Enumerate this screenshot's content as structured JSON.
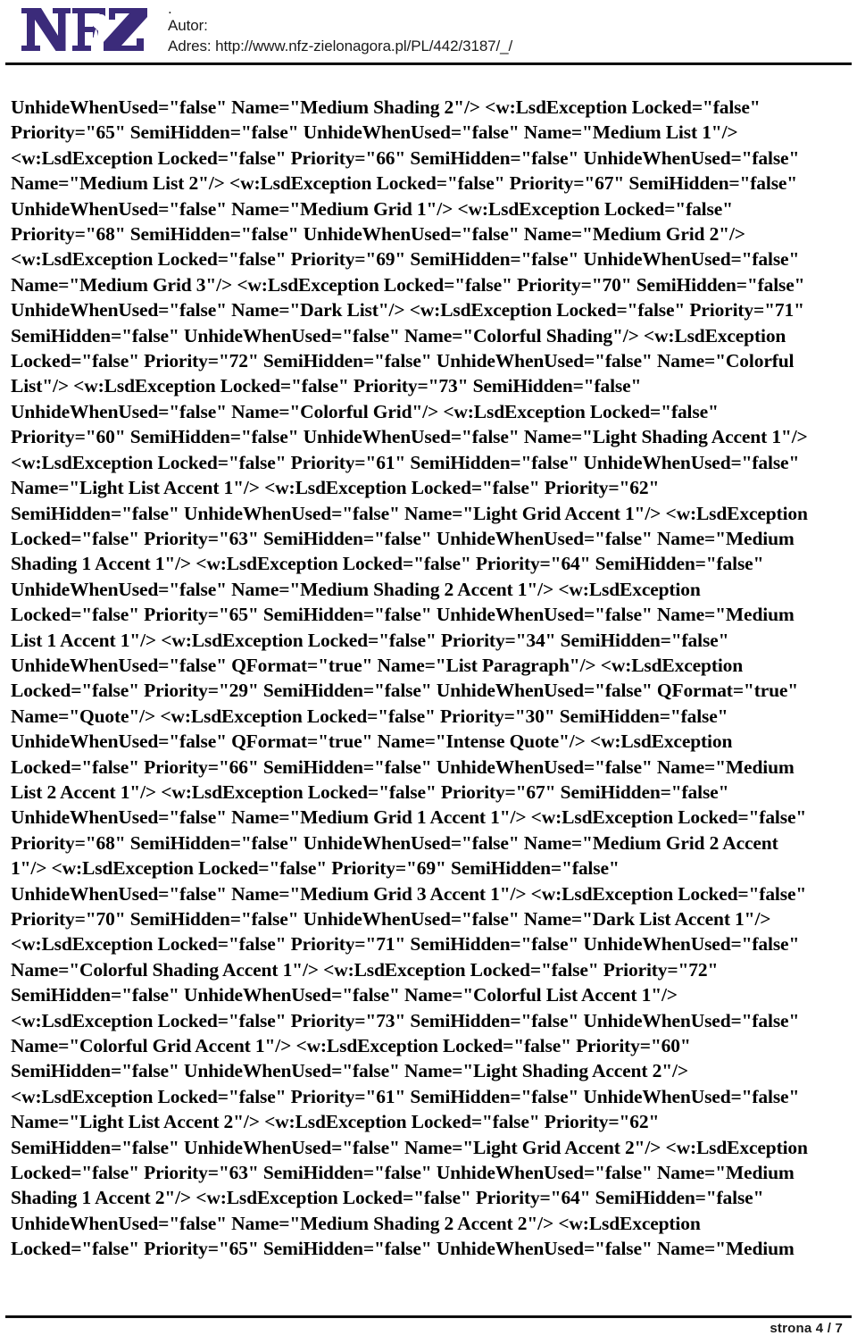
{
  "header": {
    "logo_alt": "NFZ",
    "logo_color": "#3B2B7A",
    "meta_lines": [
      ".",
      "Autor:",
      "Adres: http://www.nfz-zielonagora.pl/PL/442/3187/_/"
    ]
  },
  "body": {
    "lines": [
      "UnhideWhenUsed=\"false\" Name=\"Medium Shading 2\"/> <w:LsdException Locked=\"false\"",
      "Priority=\"65\" SemiHidden=\"false\" UnhideWhenUsed=\"false\" Name=\"Medium List 1\"/>",
      "<w:LsdException Locked=\"false\" Priority=\"66\" SemiHidden=\"false\" UnhideWhenUsed=\"false\"",
      "Name=\"Medium List 2\"/> <w:LsdException Locked=\"false\" Priority=\"67\" SemiHidden=\"false\"",
      "UnhideWhenUsed=\"false\" Name=\"Medium Grid 1\"/> <w:LsdException Locked=\"false\"",
      "Priority=\"68\" SemiHidden=\"false\" UnhideWhenUsed=\"false\" Name=\"Medium Grid 2\"/>",
      "<w:LsdException Locked=\"false\" Priority=\"69\" SemiHidden=\"false\" UnhideWhenUsed=\"false\"",
      "Name=\"Medium Grid 3\"/> <w:LsdException Locked=\"false\" Priority=\"70\" SemiHidden=\"false\"",
      "UnhideWhenUsed=\"false\" Name=\"Dark List\"/> <w:LsdException Locked=\"false\" Priority=\"71\"",
      "SemiHidden=\"false\" UnhideWhenUsed=\"false\" Name=\"Colorful Shading\"/> <w:LsdException",
      "Locked=\"false\" Priority=\"72\" SemiHidden=\"false\" UnhideWhenUsed=\"false\" Name=\"Colorful",
      "List\"/> <w:LsdException Locked=\"false\" Priority=\"73\" SemiHidden=\"false\"",
      "UnhideWhenUsed=\"false\" Name=\"Colorful Grid\"/> <w:LsdException Locked=\"false\"",
      "Priority=\"60\" SemiHidden=\"false\" UnhideWhenUsed=\"false\" Name=\"Light Shading Accent 1\"/>",
      "<w:LsdException Locked=\"false\" Priority=\"61\" SemiHidden=\"false\" UnhideWhenUsed=\"false\"",
      "Name=\"Light List Accent 1\"/> <w:LsdException Locked=\"false\" Priority=\"62\"",
      "SemiHidden=\"false\" UnhideWhenUsed=\"false\" Name=\"Light Grid Accent 1\"/> <w:LsdException",
      "Locked=\"false\" Priority=\"63\" SemiHidden=\"false\" UnhideWhenUsed=\"false\" Name=\"Medium",
      "Shading 1 Accent 1\"/> <w:LsdException Locked=\"false\" Priority=\"64\" SemiHidden=\"false\"",
      "UnhideWhenUsed=\"false\" Name=\"Medium Shading 2 Accent 1\"/> <w:LsdException",
      "Locked=\"false\" Priority=\"65\" SemiHidden=\"false\" UnhideWhenUsed=\"false\" Name=\"Medium",
      "List 1 Accent 1\"/> <w:LsdException Locked=\"false\" Priority=\"34\" SemiHidden=\"false\"",
      "UnhideWhenUsed=\"false\" QFormat=\"true\" Name=\"List Paragraph\"/> <w:LsdException",
      "Locked=\"false\" Priority=\"29\" SemiHidden=\"false\" UnhideWhenUsed=\"false\" QFormat=\"true\"",
      "Name=\"Quote\"/> <w:LsdException Locked=\"false\" Priority=\"30\" SemiHidden=\"false\"",
      "UnhideWhenUsed=\"false\" QFormat=\"true\" Name=\"Intense Quote\"/> <w:LsdException",
      "Locked=\"false\" Priority=\"66\" SemiHidden=\"false\" UnhideWhenUsed=\"false\" Name=\"Medium",
      "List 2 Accent 1\"/> <w:LsdException Locked=\"false\" Priority=\"67\" SemiHidden=\"false\"",
      "UnhideWhenUsed=\"false\" Name=\"Medium Grid 1 Accent 1\"/> <w:LsdException Locked=\"false\"",
      "Priority=\"68\" SemiHidden=\"false\" UnhideWhenUsed=\"false\" Name=\"Medium Grid 2 Accent",
      "1\"/> <w:LsdException Locked=\"false\" Priority=\"69\" SemiHidden=\"false\"",
      "UnhideWhenUsed=\"false\" Name=\"Medium Grid 3 Accent 1\"/> <w:LsdException Locked=\"false\"",
      "Priority=\"70\" SemiHidden=\"false\" UnhideWhenUsed=\"false\" Name=\"Dark List Accent 1\"/>",
      "<w:LsdException Locked=\"false\" Priority=\"71\" SemiHidden=\"false\" UnhideWhenUsed=\"false\"",
      "Name=\"Colorful Shading Accent 1\"/> <w:LsdException Locked=\"false\" Priority=\"72\"",
      "SemiHidden=\"false\" UnhideWhenUsed=\"false\" Name=\"Colorful List Accent 1\"/>",
      "<w:LsdException Locked=\"false\" Priority=\"73\" SemiHidden=\"false\" UnhideWhenUsed=\"false\"",
      "Name=\"Colorful Grid Accent 1\"/> <w:LsdException Locked=\"false\" Priority=\"60\"",
      "SemiHidden=\"false\" UnhideWhenUsed=\"false\" Name=\"Light Shading Accent 2\"/>",
      "<w:LsdException Locked=\"false\" Priority=\"61\" SemiHidden=\"false\" UnhideWhenUsed=\"false\"",
      "Name=\"Light List Accent 2\"/> <w:LsdException Locked=\"false\" Priority=\"62\"",
      "SemiHidden=\"false\" UnhideWhenUsed=\"false\" Name=\"Light Grid Accent 2\"/> <w:LsdException",
      "Locked=\"false\" Priority=\"63\" SemiHidden=\"false\" UnhideWhenUsed=\"false\" Name=\"Medium",
      "Shading 1 Accent 2\"/> <w:LsdException Locked=\"false\" Priority=\"64\" SemiHidden=\"false\"",
      "UnhideWhenUsed=\"false\" Name=\"Medium Shading 2 Accent 2\"/> <w:LsdException",
      "Locked=\"false\" Priority=\"65\" SemiHidden=\"false\" UnhideWhenUsed=\"false\" Name=\"Medium"
    ]
  },
  "footer": {
    "page_label": "strona 4 / 7"
  }
}
